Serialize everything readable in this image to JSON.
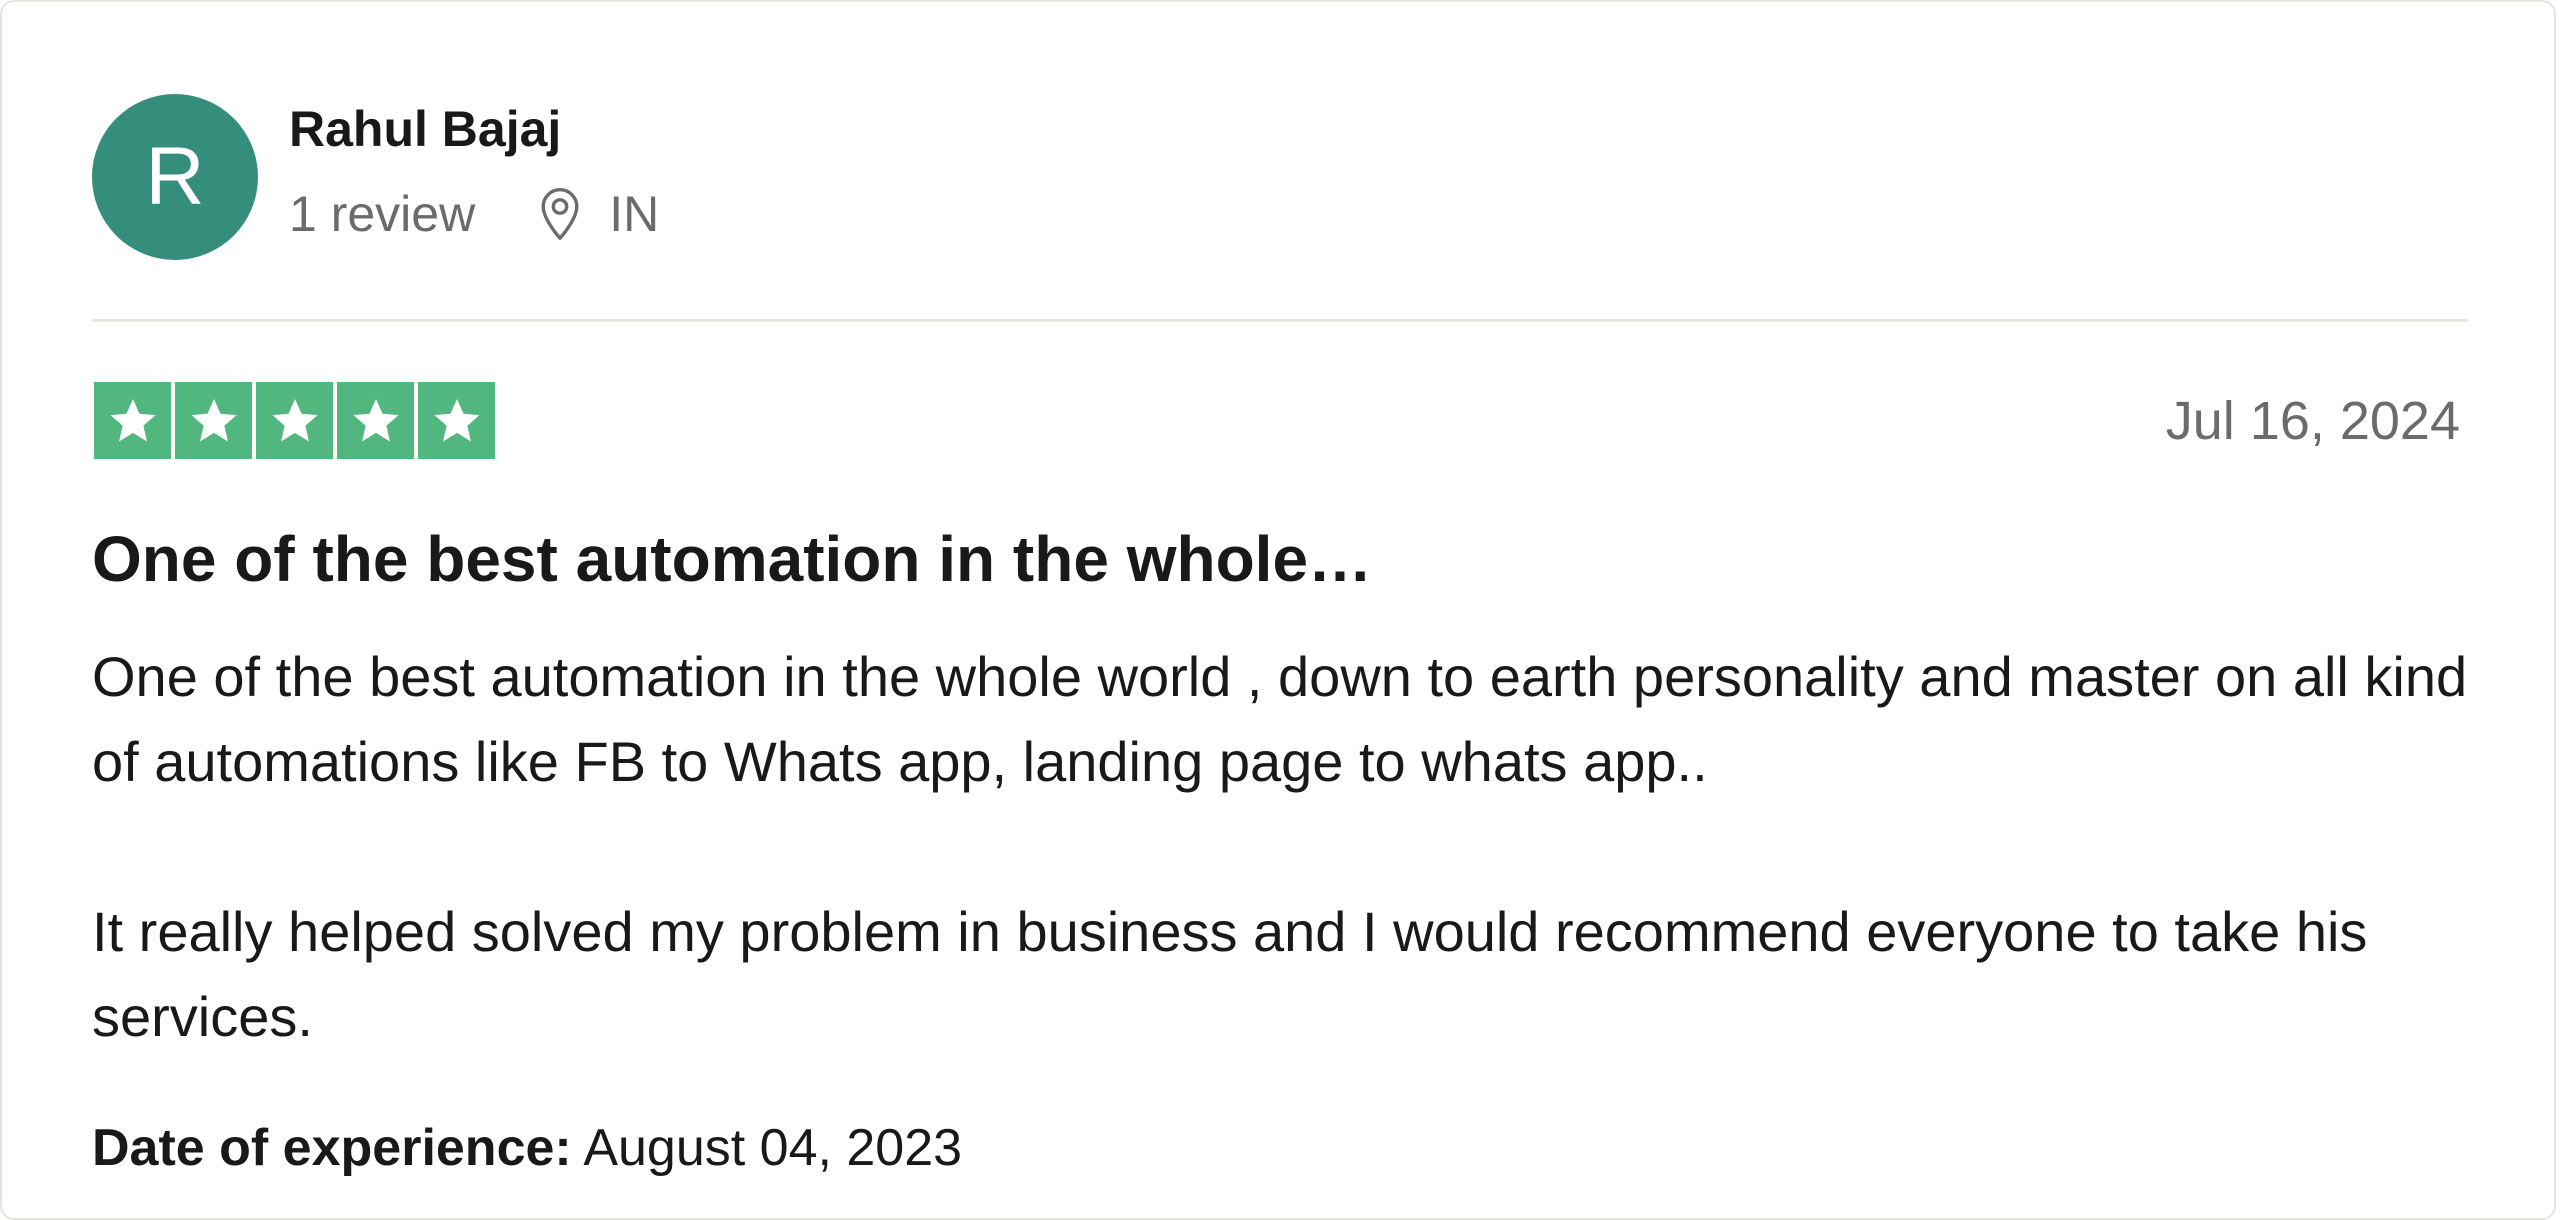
{
  "reviewer": {
    "initial": "R",
    "name": "Rahul Bajaj",
    "review_count": "1 review",
    "location": "IN",
    "avatar_color": "#358e7c"
  },
  "rating": {
    "stars": 5,
    "max_stars": 5,
    "star_color": "#52b77e"
  },
  "review": {
    "date": "Jul 16, 2024",
    "title": "One of the best automation in the whole…",
    "body_paragraph_1": "One of the best automation in the whole world , down to earth personality and master on all kind of automations like FB to Whats app, landing page to whats app..",
    "body_paragraph_2": "It really helped solved my problem in business and I would recommend everyone to take his services.",
    "experience_label": "Date of experience:",
    "experience_date": "August 04, 2023"
  }
}
